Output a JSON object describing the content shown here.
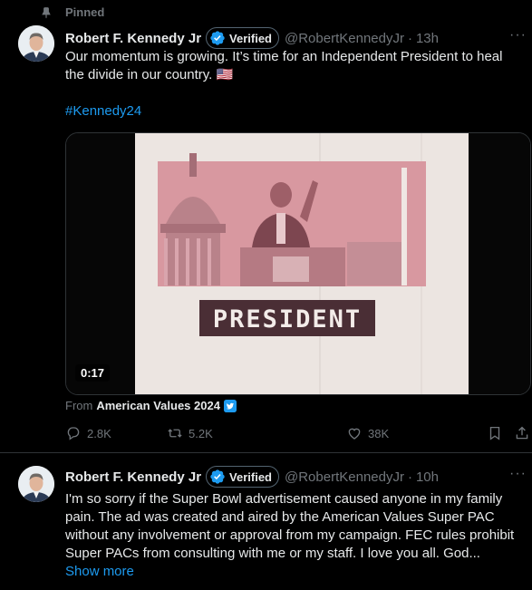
{
  "tweets": [
    {
      "pinned_label": "Pinned",
      "author_name": "Robert F. Kennedy Jr",
      "verified_label": "Verified",
      "handle": "@RobertKennedyJr",
      "time": "13h",
      "more": "···",
      "text": "Our momentum is growing. It’s time for an Independent President to heal the divide in our country. 🇺🇸",
      "hashtag": "#Kennedy24",
      "media": {
        "banner_text": "PRESIDENT",
        "duration": "0:17"
      },
      "from_prefix": "From",
      "from_source": "American Values 2024",
      "stats": {
        "replies": "2.8K",
        "reposts": "5.2K",
        "likes": "38K"
      }
    },
    {
      "author_name": "Robert F. Kennedy Jr",
      "verified_label": "Verified",
      "handle": "@RobertKennedyJr",
      "time": "10h",
      "more": "···",
      "text": "I'm so sorry if the Super Bowl advertisement caused anyone in my family pain. The ad was created and aired by the American Values Super PAC without any involvement or approval from my campaign. FEC rules prohibit Super PACs from consulting with me or my staff. I love you all. God...",
      "show_more": "Show more"
    }
  ],
  "colors": {
    "background": "#000000",
    "text": "#e7e9ea",
    "muted": "#71767b",
    "accent": "#1d9bf0",
    "divider": "#2f3336"
  },
  "icons": [
    "pin-icon",
    "verified-badge-icon",
    "more-icon",
    "reply-icon",
    "repost-icon",
    "like-icon",
    "bookmark-icon",
    "share-icon"
  ]
}
